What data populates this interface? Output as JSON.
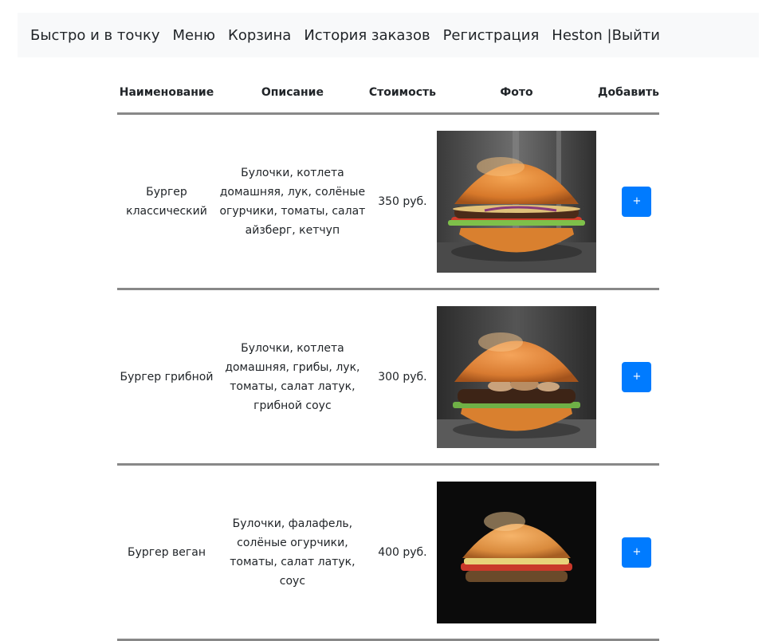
{
  "nav": {
    "brand": "Быстро и в точку",
    "menu": "Меню",
    "cart": "Корзина",
    "history": "История заказов",
    "register": "Регистрация",
    "user": "Heston",
    "separator": "|",
    "logout": "Выйти"
  },
  "table": {
    "headers": {
      "name": "Наименование",
      "description": "Описание",
      "price": "Стоимость",
      "photo": "Фото",
      "add": "Добавить"
    },
    "rows": [
      {
        "name": "Бургер классический",
        "description": "Булочки, котлета домашняя, лук, солёные огурчики, томаты, салат айзберг, кетчуп",
        "price": "350 руб.",
        "add_label": "+"
      },
      {
        "name": "Бургер грибной",
        "description": "Булочки, котлета домашняя, грибы, лук, томаты, салат латук, грибной соус",
        "price": "300 руб.",
        "add_label": "+"
      },
      {
        "name": "Бургер веган",
        "description": "Булочки, фалафель, солёные огурчики, томаты, салат латук, соус",
        "price": "400 руб.",
        "add_label": "+"
      }
    ]
  },
  "colors": {
    "navbar_bg": "#f8f9fa",
    "button": "#007bff",
    "divider": "#888888"
  }
}
